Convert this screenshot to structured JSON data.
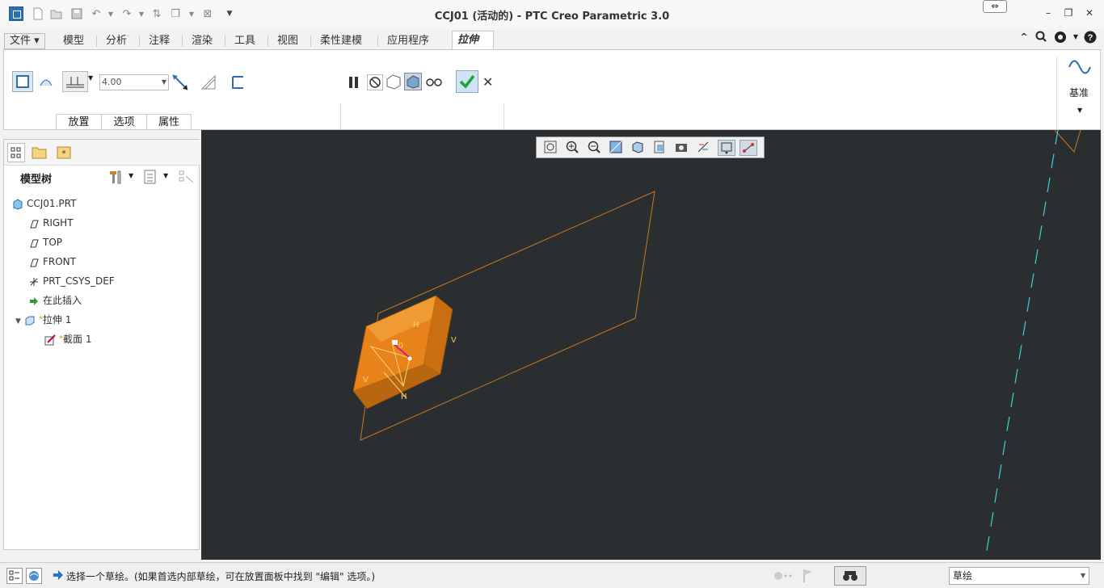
{
  "window": {
    "title": "CCJ01 (活动的) - PTC Creo Parametric 3.0",
    "restore_handle_icon": "⇔",
    "min_icon": "–",
    "max_icon": "❐",
    "close_icon": "✕"
  },
  "quick_access": [
    "new-icon",
    "open-icon",
    "save-icon",
    "undo-icon",
    "redo-icon",
    "regenerate-icon",
    "windows-icon",
    "close-window-icon",
    "customize-icon"
  ],
  "tabs": {
    "file": "文件",
    "items": [
      "模型",
      "分析",
      "注释",
      "渲染",
      "工具",
      "视图",
      "柔性建模",
      "应用程序"
    ],
    "active": "拉伸"
  },
  "ribbon": {
    "depth_value": "4.00",
    "subtabs": [
      "放置",
      "选项",
      "属性"
    ],
    "datum_label": "基准"
  },
  "model_tree": {
    "header": "模型树",
    "items": [
      {
        "label": "CCJ01.PRT",
        "icon": "part-icon"
      },
      {
        "label": "RIGHT",
        "icon": "datum-plane-icon"
      },
      {
        "label": "TOP",
        "icon": "datum-plane-icon"
      },
      {
        "label": "FRONT",
        "icon": "datum-plane-icon"
      },
      {
        "label": "PRT_CSYS_DEF",
        "icon": "csys-icon"
      },
      {
        "label": "在此插入",
        "icon": "insert-arrow-icon"
      },
      {
        "label": "拉伸 1",
        "icon": "extrude-icon"
      },
      {
        "label": "截面 1",
        "icon": "sketch-icon"
      }
    ]
  },
  "viewport": {
    "dim_labels": {
      "h_top": "H",
      "v_right": "V",
      "v_left": "V",
      "h_bottom": "H",
      "num": "0"
    },
    "colors": {
      "background": "#2a2e30",
      "solid": "#e8821a",
      "outline": "#c8781f",
      "axis": "#3fd0d8"
    }
  },
  "status": {
    "message": "选择一个草绘。(如果首选内部草绘，可在放置面板中找到 \"编辑\" 选项。)",
    "filter_value": "草绘"
  }
}
